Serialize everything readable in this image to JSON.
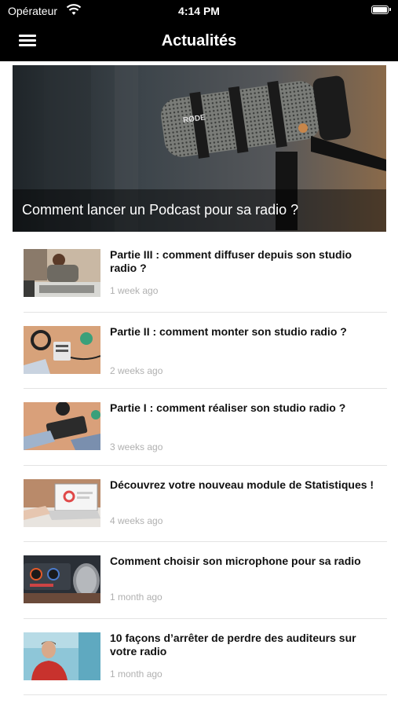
{
  "status_bar": {
    "carrier": "Opérateur",
    "time": "4:14 PM",
    "icons": [
      "wifi-icon",
      "battery-icon"
    ]
  },
  "nav": {
    "title": "Actualités",
    "menu_icon": "hamburger-menu-icon"
  },
  "featured": {
    "title": "Comment lancer un Podcast pour sa radio ?",
    "image": "microphone-photo",
    "mic_brand": "RØDE"
  },
  "articles": [
    {
      "title": "Partie III : comment diffuser depuis son studio radio ?",
      "date": "1 week ago",
      "image": "studio-mixer-photo"
    },
    {
      "title": "Partie II : comment monter son studio radio ?",
      "date": "2 weeks ago",
      "image": "headphones-mixer-photo"
    },
    {
      "title": "Partie I : comment réaliser son studio radio ?",
      "date": "3 weeks ago",
      "image": "hands-mixer-photo"
    },
    {
      "title": "Découvrez votre nouveau module de Statistiques !",
      "date": "4 weeks ago",
      "image": "laptop-statistics-photo"
    },
    {
      "title": "Comment choisir son microphone pour sa radio",
      "date": "1 month ago",
      "image": "microphone-interface-photo"
    },
    {
      "title": "10 façons d’arrêter de perdre des auditeurs sur votre radio",
      "date": "1 month ago",
      "image": "man-portrait-photo"
    }
  ]
}
